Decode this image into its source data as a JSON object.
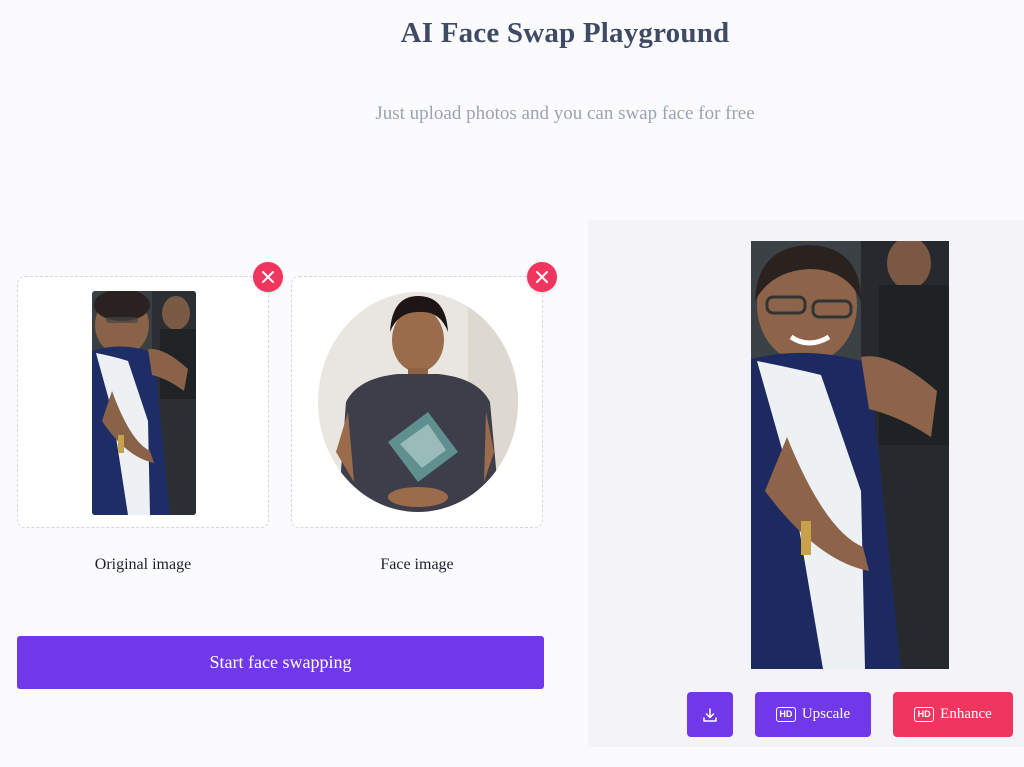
{
  "header": {
    "title": "AI Face Swap Playground",
    "subtitle": "Just upload photos and you can swap face for free"
  },
  "uploads": {
    "original": {
      "label": "Original image",
      "remove_icon": "close-icon"
    },
    "face": {
      "label": "Face image",
      "remove_icon": "close-icon"
    }
  },
  "actions": {
    "start_label": "Start face swapping"
  },
  "result": {
    "download_icon": "download-icon",
    "upscale": {
      "badge": "HD",
      "label": "Upscale"
    },
    "enhance": {
      "badge": "HD",
      "label": "Enhance"
    }
  },
  "colors": {
    "primary": "#7038e8",
    "danger": "#f0355e",
    "title": "#3f4a64",
    "subtitle": "#9aa3b4"
  }
}
